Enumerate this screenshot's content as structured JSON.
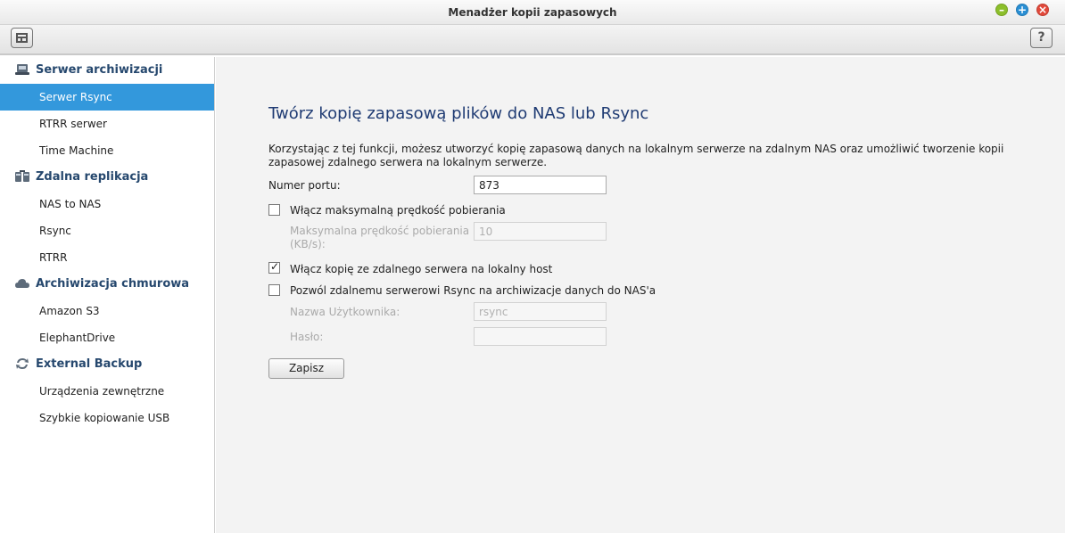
{
  "window": {
    "title": "Menadżer kopii zapasowych",
    "help_label": "?"
  },
  "sidebar": {
    "categories": [
      {
        "label": "Serwer archiwizacji",
        "icon": "server-icon",
        "items": [
          {
            "label": "Serwer Rsync",
            "active": true
          },
          {
            "label": "RTRR serwer"
          },
          {
            "label": "Time Machine"
          }
        ]
      },
      {
        "label": "Zdalna replikacja",
        "icon": "replication-icon",
        "items": [
          {
            "label": "NAS to NAS"
          },
          {
            "label": "Rsync"
          },
          {
            "label": "RTRR"
          }
        ]
      },
      {
        "label": "Archiwizacja chmurowa",
        "icon": "cloud-icon",
        "items": [
          {
            "label": "Amazon S3"
          },
          {
            "label": "ElephantDrive"
          }
        ]
      },
      {
        "label": "External Backup",
        "icon": "sync-arrows-icon",
        "items": [
          {
            "label": "Urządzenia zewnętrzne"
          },
          {
            "label": "Szybkie kopiowanie USB"
          }
        ]
      }
    ]
  },
  "main": {
    "heading": "Twórz kopię zapasową plików do NAS lub Rsync",
    "description": "Korzystając z tej funkcji, możesz utworzyć kopię zapasową danych na lokalnym serwerze na zdalnym NAS oraz umożliwić tworzenie kopii zapasowej zdalnego serwera na lokalnym serwerze.",
    "port_label": "Numer portu:",
    "port_value": "873",
    "max_speed_checkbox_label": "Włącz maksymalną prędkość pobierania",
    "max_speed_checked": false,
    "max_speed_label_line1": "Maksymalna prędkość pobierania",
    "max_speed_label_line2": "(KB/s):",
    "max_speed_value": "10",
    "remote_to_local_checkbox_label": "Włącz kopię ze zdalnego serwera na lokalny host",
    "remote_to_local_checked": true,
    "allow_rsync_checkbox_label": "Pozwól zdalnemu serwerowi Rsync na archiwizacje danych do NAS'a",
    "allow_rsync_checked": false,
    "username_label": "Nazwa Użytkownika:",
    "username_value": "rsync",
    "password_label": "Hasło:",
    "password_value": "",
    "save_label": "Zapisz"
  },
  "colors": {
    "accent": "#3398dc",
    "heading": "#1f3b73",
    "category": "#26486e"
  }
}
